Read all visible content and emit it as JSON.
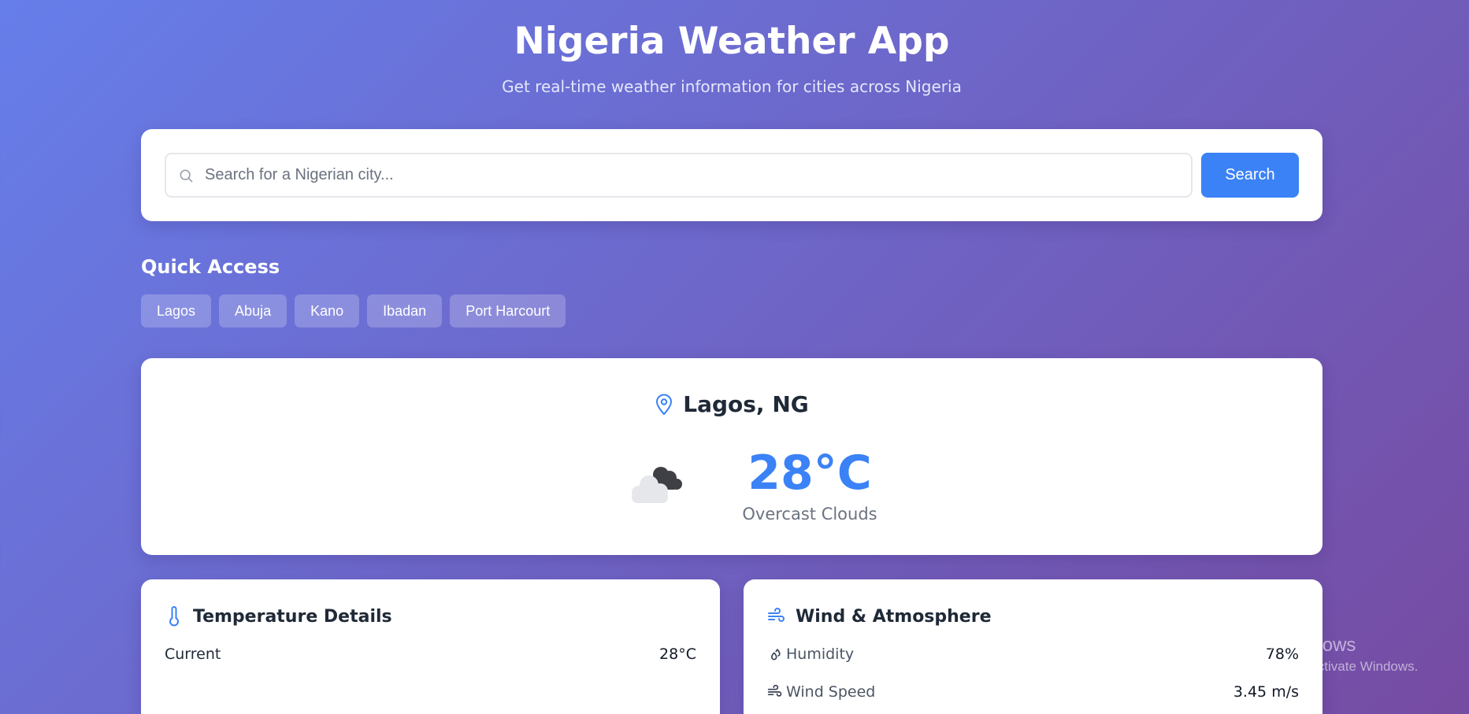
{
  "header": {
    "title": "Nigeria Weather App",
    "subtitle": "Get real-time weather information for cities across Nigeria"
  },
  "search": {
    "placeholder": "Search for a Nigerian city...",
    "value": "",
    "button_label": "Search"
  },
  "quick_access": {
    "title": "Quick Access",
    "cities": [
      "Lagos",
      "Abuja",
      "Kano",
      "Ibadan",
      "Port Harcourt"
    ]
  },
  "current": {
    "location": "Lagos, NG",
    "temperature": "28°C",
    "description": "Overcast Clouds",
    "icon": "overcast-clouds-icon"
  },
  "temperature_details": {
    "title": "Temperature Details",
    "icon": "thermometer-icon",
    "rows": [
      {
        "label": "Current",
        "value": "28°C"
      }
    ]
  },
  "wind_atmosphere": {
    "title": "Wind & Atmosphere",
    "icon": "wind-icon",
    "rows": [
      {
        "label": "Humidity",
        "value": "78%",
        "icon": "droplets-icon"
      },
      {
        "label": "Wind Speed",
        "value": "3.45 m/s",
        "icon": "wind-icon"
      }
    ]
  },
  "watermark": {
    "title": "Activate Windows",
    "subtitle": "Go to Settings to activate Windows."
  },
  "colors": {
    "accent": "#3b82f6",
    "gradient_start": "#667eea",
    "gradient_end": "#764ba2"
  }
}
